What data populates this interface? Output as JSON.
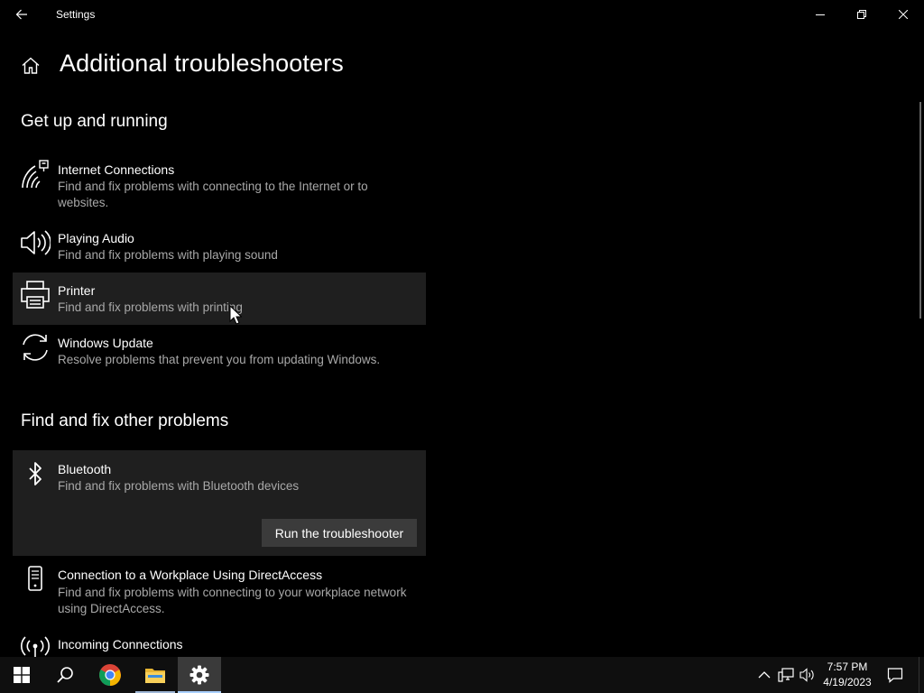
{
  "window": {
    "title": "Settings",
    "controls": {
      "minimize": "minimize-icon",
      "maximize": "restore-icon",
      "close": "close-icon"
    }
  },
  "page": {
    "title": "Additional troubleshooters"
  },
  "sections": [
    {
      "title": "Get up and running",
      "items": [
        {
          "icon": "wifi-ethernet-icon",
          "title": "Internet Connections",
          "description": "Find and fix problems with connecting to the Internet or to websites."
        },
        {
          "icon": "speaker-icon",
          "title": "Playing Audio",
          "description": "Find and fix problems with playing sound"
        },
        {
          "icon": "printer-icon",
          "title": "Printer",
          "description": "Find and fix problems with printing"
        },
        {
          "icon": "refresh-icon",
          "title": "Windows Update",
          "description": "Resolve problems that prevent you from updating Windows."
        }
      ]
    },
    {
      "title": "Find and fix other problems",
      "items": [
        {
          "icon": "bluetooth-icon",
          "title": "Bluetooth",
          "description": "Find and fix problems with Bluetooth devices",
          "button": "Run the troubleshooter"
        },
        {
          "icon": "phone-icon",
          "title": "Connection to a Workplace Using DirectAccess",
          "description": "Find and fix problems with connecting to your workplace network using DirectAccess."
        },
        {
          "icon": "antenna-icon",
          "title": "Incoming Connections",
          "description": ""
        }
      ]
    }
  ],
  "taskbar": {
    "apps": [
      "start-icon",
      "search-icon",
      "chrome-icon",
      "file-explorer-icon",
      "settings-gear-icon"
    ],
    "tray": [
      "chevron-up-icon",
      "network-icon",
      "volume-icon"
    ],
    "time": "7:57 PM",
    "date": "4/19/2023"
  },
  "colors": {
    "background": "#000000",
    "hover": "#1f1f1f",
    "button": "#3b3b3b",
    "secondary_text": "#a8a8a8"
  }
}
